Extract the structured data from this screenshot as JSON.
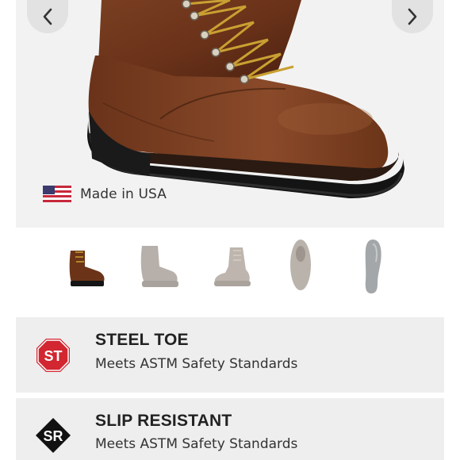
{
  "gallery": {
    "prev_icon": "chevron-left-icon",
    "next_icon": "chevron-right-icon",
    "origin_label": "Made in USA",
    "origin_icon": "us-flag-icon",
    "thumbnails": [
      {
        "view": "side",
        "selected": true
      },
      {
        "view": "three-quarter",
        "selected": false
      },
      {
        "view": "back-angle",
        "selected": false
      },
      {
        "view": "top",
        "selected": false
      },
      {
        "view": "sole",
        "selected": false
      }
    ]
  },
  "features": [
    {
      "badge": "ST",
      "badge_color": "#d22630",
      "title": "STEEL TOE",
      "description": "Meets ASTM Safety Standards"
    },
    {
      "badge": "SR",
      "badge_color": "#111111",
      "title": "SLIP RESISTANT",
      "description": "Meets ASTM Safety Standards"
    }
  ]
}
